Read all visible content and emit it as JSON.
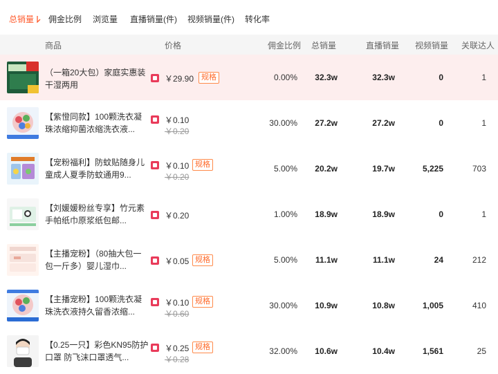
{
  "sort_tabs": [
    "总销量",
    "佣金比例",
    "浏览量",
    "直播销量(件)",
    "视频销量(件)",
    "转化率"
  ],
  "columns": {
    "product": "商品",
    "price": "价格",
    "commission": "佣金比例",
    "total_sales": "总销量",
    "live_sales": "直播销量",
    "video_sales": "视频销量",
    "influencers": "关联达人"
  },
  "colors": {
    "accent": "#ff5a2c",
    "highlight_row": "#fdeeee",
    "shop_icon": "#e93b5a"
  },
  "rows": [
    {
      "name": "（一箱20大包）家庭实惠装 干湿两用",
      "price": "￥29.90",
      "original_price": "",
      "spec": "规格",
      "commission": "0.00%",
      "total_sales": "32.3w",
      "live_sales": "32.3w",
      "video_sales": "0",
      "influencers": "1",
      "thumb_text": "20包"
    },
    {
      "name": "【紫憕同款】100颗洗衣凝珠浓缩抑菌浓缩洗衣液...",
      "price": "￥0.10",
      "original_price": "￥0.20",
      "spec": "",
      "commission": "30.00%",
      "total_sales": "27.2w",
      "live_sales": "27.2w",
      "video_sales": "0",
      "influencers": "1",
      "thumb_text": ""
    },
    {
      "name": "【宠粉福利】防蚊贴随身儿童成人夏季防蚊通用9...",
      "price": "￥0.10",
      "original_price": "￥0.20",
      "spec": "规格",
      "commission": "5.00%",
      "total_sales": "20.2w",
      "live_sales": "19.7w",
      "video_sales": "5,225",
      "influencers": "703",
      "thumb_text": ""
    },
    {
      "name": "【刘媛媛粉丝专享】竹元素手帕纸巾原浆纸包邮...",
      "price": "￥0.20",
      "original_price": "",
      "spec": "",
      "commission": "1.00%",
      "total_sales": "18.9w",
      "live_sales": "18.9w",
      "video_sales": "0",
      "influencers": "1",
      "thumb_text": ""
    },
    {
      "name": "【主播宠粉】（80抽大包一包一斤多）婴儿湿巾...",
      "price": "￥0.05",
      "original_price": "",
      "spec": "规格",
      "commission": "5.00%",
      "total_sales": "11.1w",
      "live_sales": "11.1w",
      "video_sales": "24",
      "influencers": "212",
      "thumb_text": ""
    },
    {
      "name": "【主播宠粉】100颗洗衣凝珠洗衣液持久留香浓缩...",
      "price": "￥0.10",
      "original_price": "￥0.60",
      "spec": "规格",
      "commission": "30.00%",
      "total_sales": "10.9w",
      "live_sales": "10.8w",
      "video_sales": "1,005",
      "influencers": "410",
      "thumb_text": ""
    },
    {
      "name": "【0.25一只】彩色KN95防护口罩 防飞沫口罩透气...",
      "price": "￥0.25",
      "original_price": "￥0.28",
      "spec": "规格",
      "commission": "32.00%",
      "total_sales": "10.6w",
      "live_sales": "10.4w",
      "video_sales": "1,561",
      "influencers": "25",
      "thumb_text": ""
    }
  ]
}
